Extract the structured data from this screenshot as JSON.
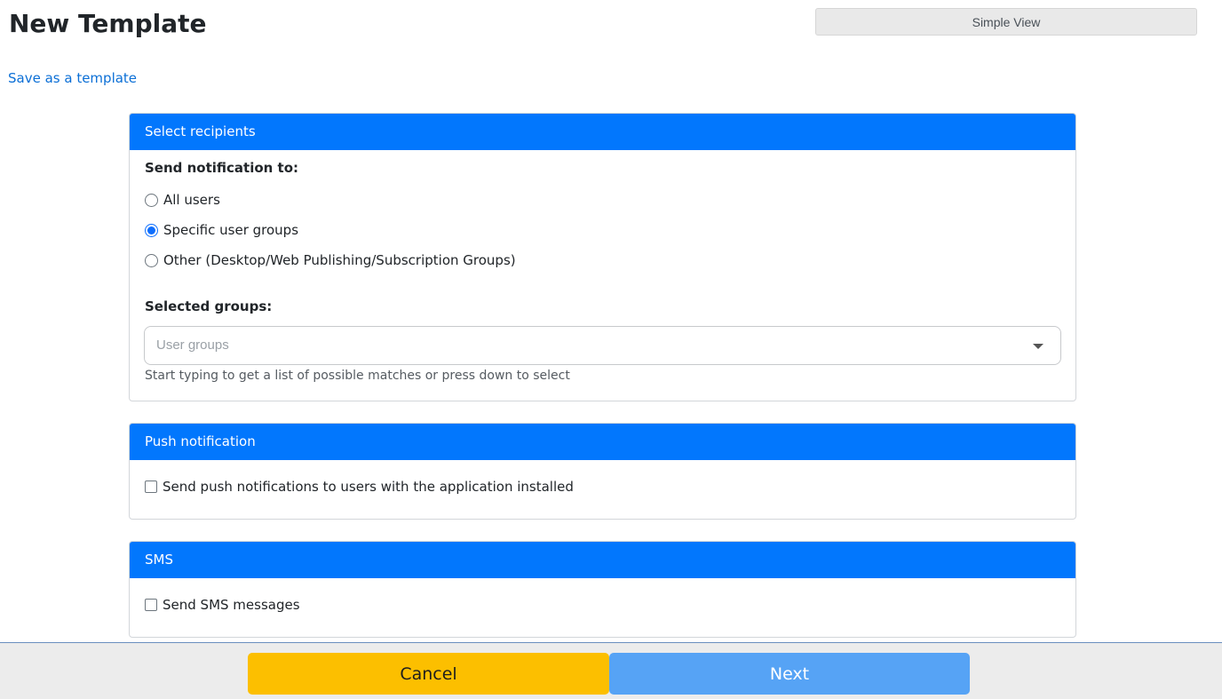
{
  "page": {
    "title": "New Template",
    "simple_view_label": "Simple View",
    "save_template_link": "Save as a template"
  },
  "recipients": {
    "header": "Select recipients",
    "send_to_label": "Send notification to:",
    "options": [
      {
        "label": "All users",
        "checked": false
      },
      {
        "label": "Specific user groups",
        "checked": true
      },
      {
        "label": "Other (Desktop/Web Publishing/Subscription Groups)",
        "checked": false
      }
    ],
    "selected_groups_label": "Selected groups:",
    "groups_placeholder": "User groups",
    "groups_value": "",
    "help_text": "Start typing to get a list of possible matches or press down to select"
  },
  "push": {
    "header": "Push notification",
    "checkbox_label": "Send push notifications to users with the application installed",
    "checked": false
  },
  "sms": {
    "header": "SMS",
    "checkbox_label": "Send SMS messages",
    "checked": false
  },
  "footer": {
    "cancel_label": "Cancel",
    "next_label": "Next"
  },
  "colors": {
    "header_blue": "#0277fd",
    "cancel_yellow": "#fcbf00",
    "next_blue": "#56a3f5",
    "link_blue": "#0b6fd6"
  }
}
